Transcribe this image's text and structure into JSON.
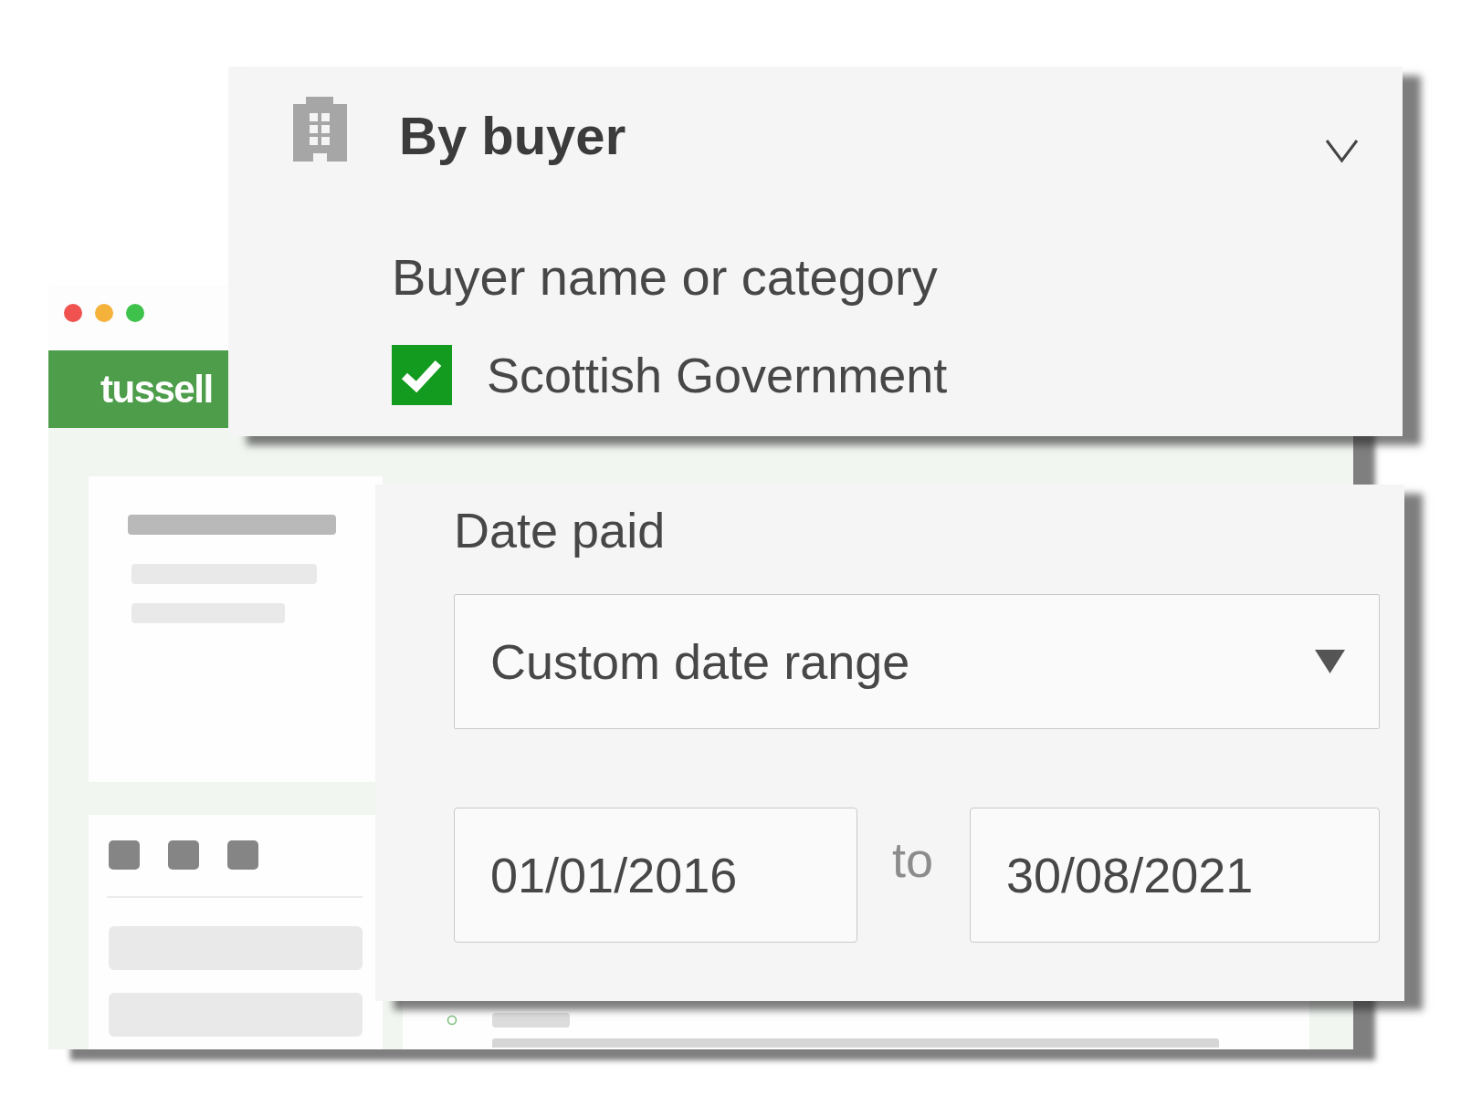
{
  "app_window": {
    "window_controls": [
      {
        "color": "#f0524f"
      },
      {
        "color": "#f5b23a"
      },
      {
        "color": "#3ec24c"
      }
    ],
    "logo": "tussell"
  },
  "buyer_filter": {
    "title": "By buyer",
    "field_label": "Buyer name or category",
    "options": [
      {
        "label": "Scottish Government",
        "checked": true
      }
    ]
  },
  "date_filter": {
    "label": "Date paid",
    "range": {
      "value": "Custom date range"
    },
    "from": {
      "value": "01/01/2016"
    },
    "separator": "to",
    "to": {
      "value": "30/08/2021"
    }
  }
}
